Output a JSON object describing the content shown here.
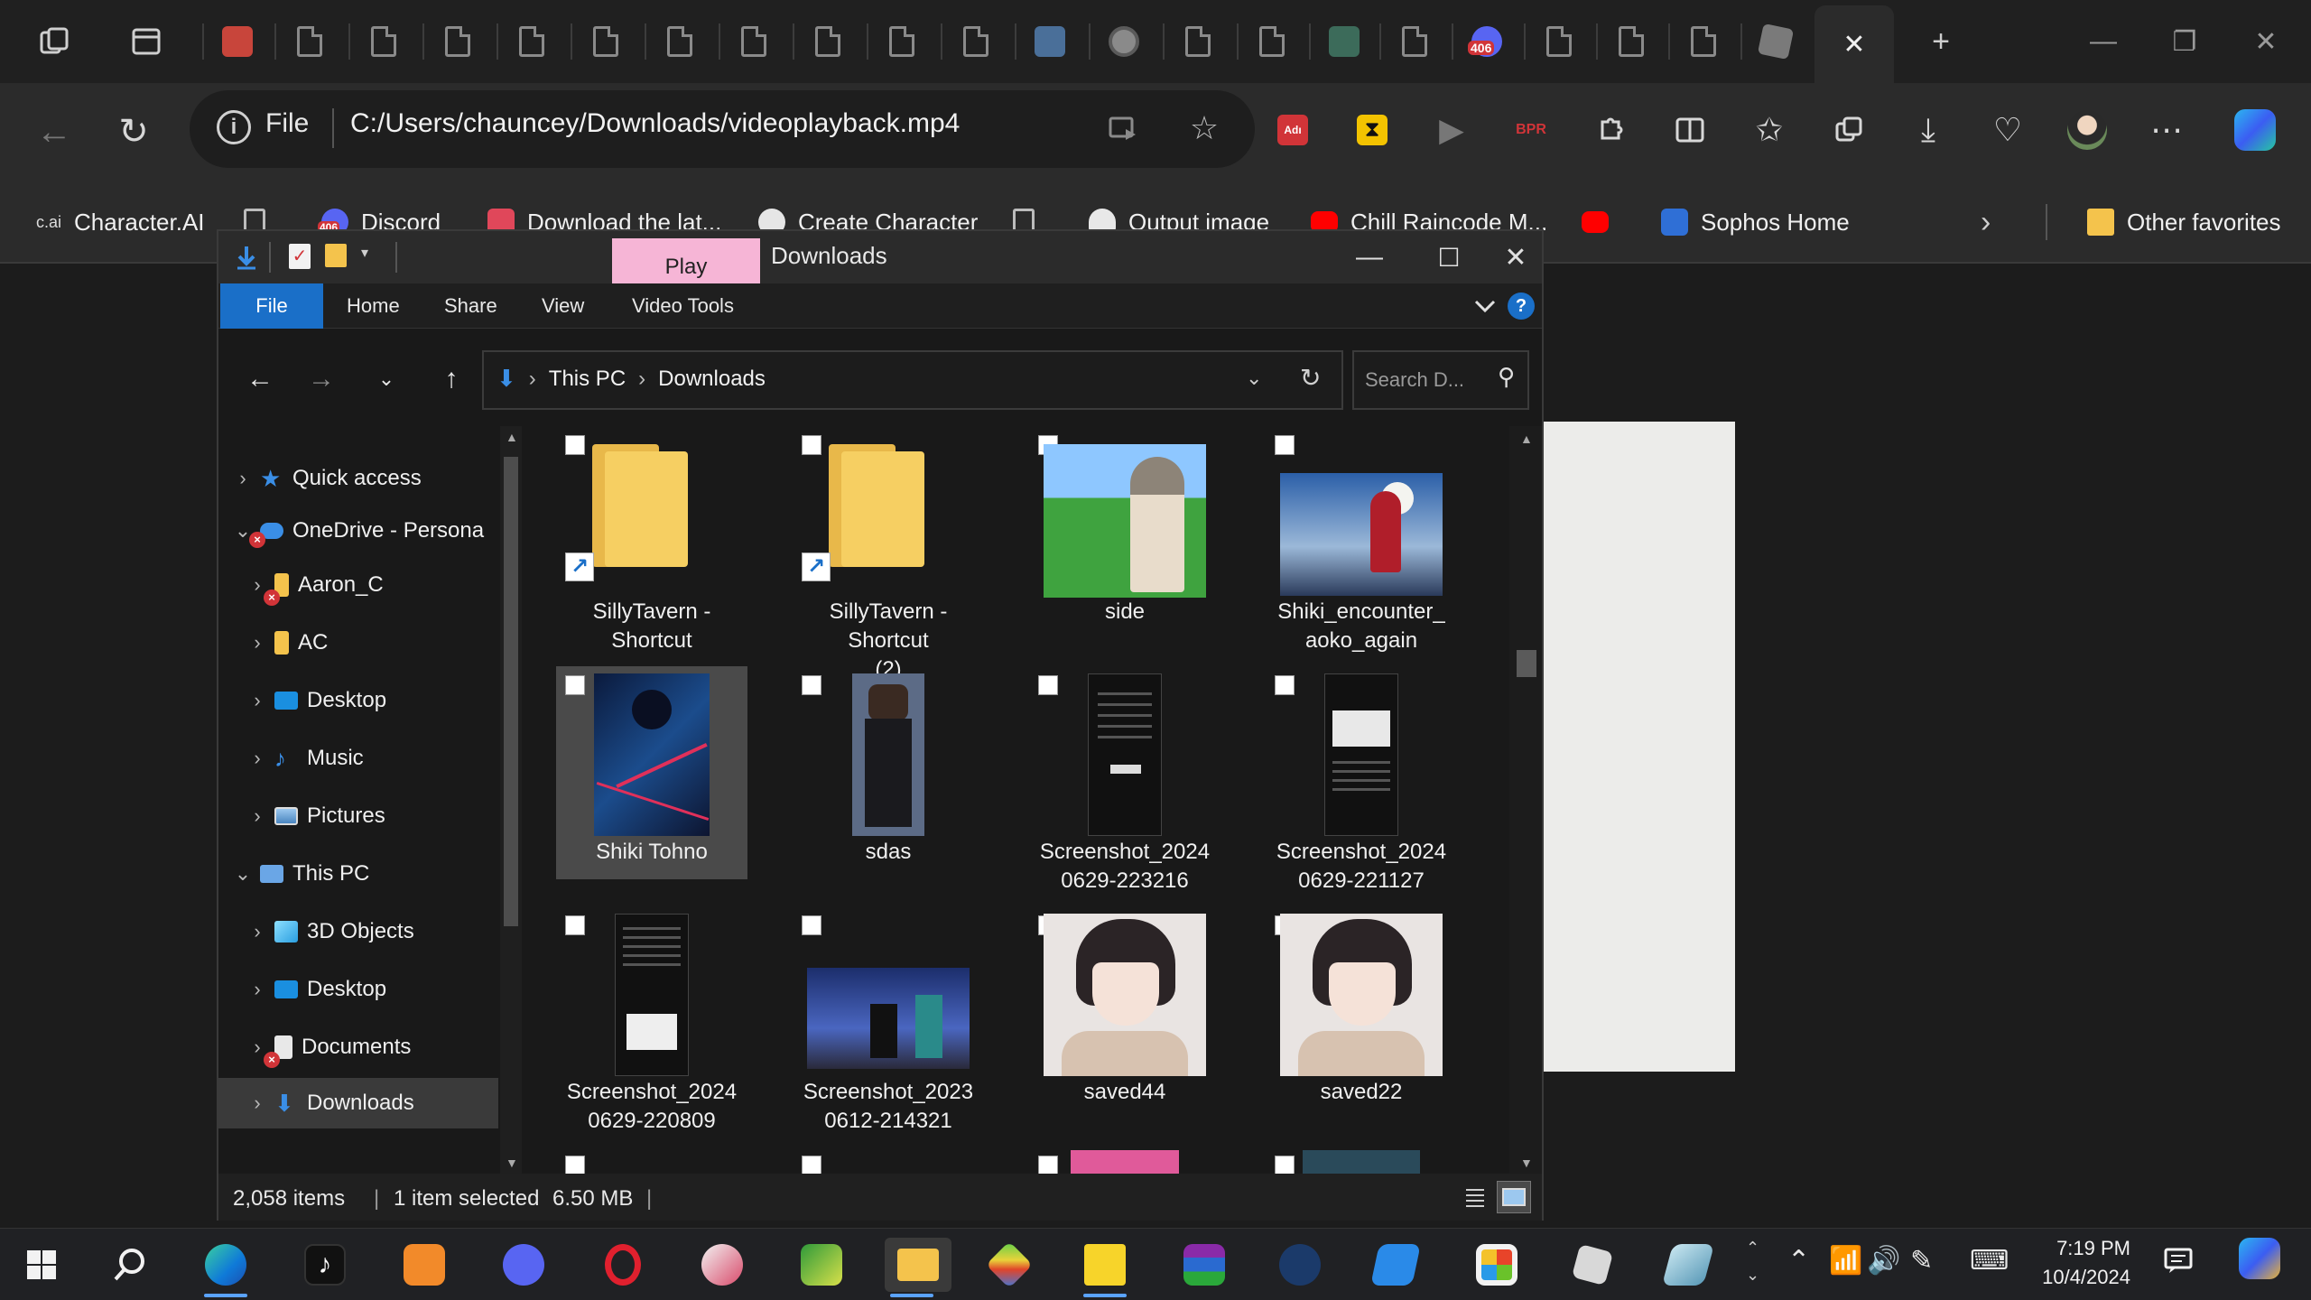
{
  "browser": {
    "active_tab_close_glyph": "✕",
    "new_tab_glyph": "+",
    "tab_badge_text": "406",
    "window_controls": {
      "minimize": "—",
      "restore": "❐",
      "close": "✕"
    }
  },
  "toolbar": {
    "back_glyph": "←",
    "reload_glyph": "↻",
    "address": {
      "scheme": "File",
      "url": "C:/Users/chauncey/Downloads/videoplayback.mp4"
    },
    "more_glyph": "⋯",
    "ext_badge_text": "Adı",
    "ext_bpr_text": "BPR"
  },
  "favorites": {
    "items": [
      {
        "label": "Character.AI",
        "icon": "character-ai-icon"
      },
      {
        "label": "",
        "icon": "page-icon"
      },
      {
        "label": "Discord",
        "icon": "discord-icon",
        "badge": "406"
      },
      {
        "label": "Download the lat...",
        "icon": "download-icon"
      },
      {
        "label": "Create Character",
        "icon": "create-icon"
      },
      {
        "label": "",
        "icon": "page-icon"
      },
      {
        "label": "Output image",
        "icon": "ghost-icon"
      },
      {
        "label": "Chill Raincode M...",
        "icon": "youtube-icon"
      },
      {
        "label": "",
        "icon": "youtube-icon"
      },
      {
        "label": "Sophos Home",
        "icon": "sophos-icon"
      }
    ],
    "overflow_glyph": "›",
    "other_favorites": "Other favorites",
    "char_ai_logo_text": "c.ai"
  },
  "explorer": {
    "context_tab": "Play",
    "window_title": "Downloads",
    "ribbon_tabs": [
      "File",
      "Home",
      "Share",
      "View",
      "Video Tools"
    ],
    "help_glyph": "?",
    "path": [
      "This PC",
      "Downloads"
    ],
    "search_placeholder": "Search D...",
    "nav": [
      {
        "label": "Quick access",
        "icon": "star-icon"
      },
      {
        "label": "OneDrive - Persona",
        "icon": "cloud-icon"
      },
      {
        "label": "Aaron_C",
        "icon": "folder-icon"
      },
      {
        "label": "AC",
        "icon": "folder-icon"
      },
      {
        "label": "Desktop",
        "icon": "desktop-icon"
      },
      {
        "label": "Music",
        "icon": "music-icon"
      },
      {
        "label": "Pictures",
        "icon": "pictures-icon"
      },
      {
        "label": "This PC",
        "icon": "pc-icon"
      },
      {
        "label": "3D Objects",
        "icon": "cube-icon"
      },
      {
        "label": "Desktop",
        "icon": "desktop-icon"
      },
      {
        "label": "Documents",
        "icon": "documents-icon"
      },
      {
        "label": "Downloads",
        "icon": "download-arrow-icon"
      }
    ],
    "files": [
      {
        "name": "SillyTavern - Shortcut",
        "kind": "folder-shortcut"
      },
      {
        "name": "SillyTavern - Shortcut (2)",
        "kind": "folder-shortcut"
      },
      {
        "name": "side",
        "kind": "image"
      },
      {
        "name": "Shiki_encounter_ aoko_again",
        "kind": "image"
      },
      {
        "name": "Shiki Tohno",
        "kind": "image",
        "selected": true
      },
      {
        "name": "sdas",
        "kind": "image"
      },
      {
        "name": "Screenshot_2024 0629-223216",
        "kind": "image"
      },
      {
        "name": "Screenshot_2024 0629-221127",
        "kind": "image"
      },
      {
        "name": "Screenshot_2024 0629-220809",
        "kind": "image"
      },
      {
        "name": "Screenshot_2023 0612-214321",
        "kind": "image"
      },
      {
        "name": "saved44",
        "kind": "image"
      },
      {
        "name": "saved22",
        "kind": "image"
      }
    ],
    "status": {
      "count": "2,058 items",
      "selected": "1 item selected",
      "size": "6.50 MB"
    }
  },
  "taskbar": {
    "clock_time": "7:19 PM",
    "clock_date": "10/4/2024"
  }
}
